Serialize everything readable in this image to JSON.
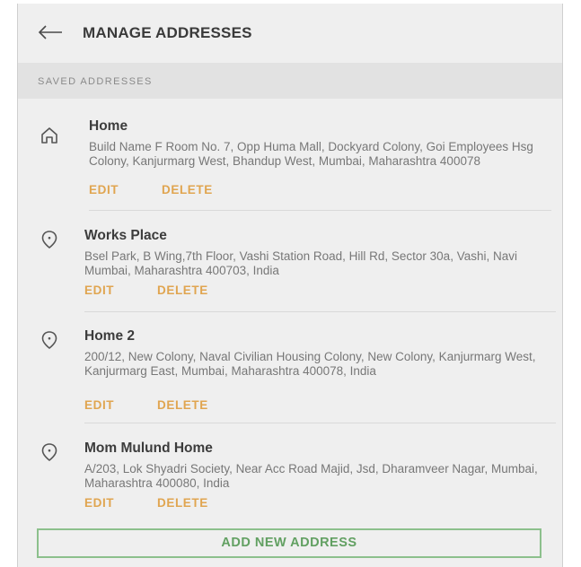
{
  "header": {
    "back_icon": "arrow-left-icon",
    "title": "MANAGE ADDRESSES"
  },
  "section": {
    "label": "SAVED ADDRESSES"
  },
  "addresses": [
    {
      "icon": "home-icon",
      "title": "Home",
      "text": "Build Name F Room No. 7, Opp Huma Mall, Dockyard Colony, Goi Employees Hsg Colony, Kanjurmarg West, Bhandup West, Mumbai, Maharashtra 400078",
      "edit_label": "EDIT",
      "delete_label": "DELETE"
    },
    {
      "icon": "location-pin-icon",
      "title": "Works Place",
      "text": "Bsel Park, B Wing,7th Floor, Vashi Station Road, Hill Rd, Sector 30a, Vashi, Navi Mumbai, Maharashtra 400703, India",
      "edit_label": "EDIT",
      "delete_label": "DELETE"
    },
    {
      "icon": "location-pin-icon",
      "title": "Home 2",
      "text": "200/12, New Colony, Naval Civilian Housing Colony, New Colony, Kanjurmarg West, Kanjurmarg East, Mumbai, Maharashtra 400078, India",
      "edit_label": "EDIT",
      "delete_label": "DELETE"
    },
    {
      "icon": "location-pin-icon",
      "title": "Mom Mulund Home",
      "text": "A/203, Lok Shyadri Society, Near Acc Road Majid, Jsd, Dharamveer Nagar, Mumbai, Maharashtra 400080, India",
      "edit_label": "EDIT",
      "delete_label": "DELETE"
    }
  ],
  "add_button": {
    "label": "ADD NEW ADDRESS"
  },
  "colors": {
    "accent_action": "#e0a550",
    "add_button_border": "#8cc08c",
    "add_button_text": "#62a062",
    "background": "#efefef"
  }
}
